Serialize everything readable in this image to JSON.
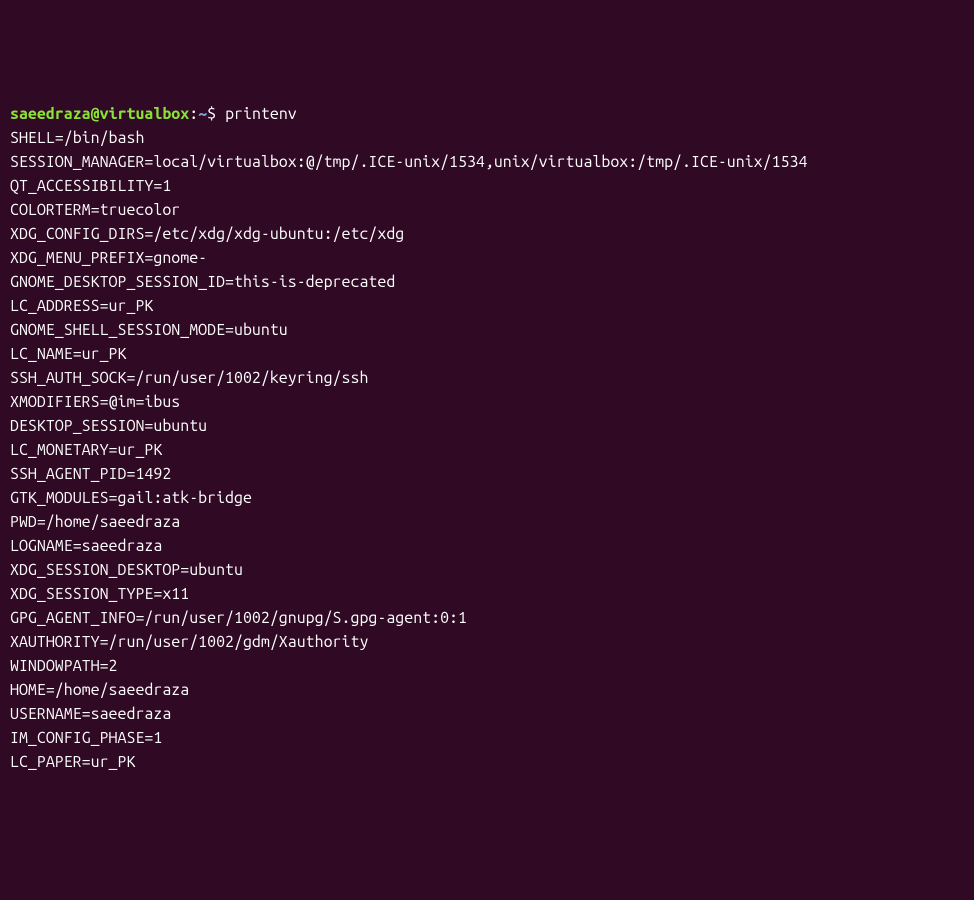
{
  "prompt": {
    "user": "saeedraza",
    "at": "@",
    "host": "virtualbox",
    "colon": ":",
    "path": "~",
    "dollar": "$ "
  },
  "command": "printenv",
  "output": [
    "SHELL=/bin/bash",
    "SESSION_MANAGER=local/virtualbox:@/tmp/.ICE-unix/1534,unix/virtualbox:/tmp/.ICE-unix/1534",
    "QT_ACCESSIBILITY=1",
    "COLORTERM=truecolor",
    "XDG_CONFIG_DIRS=/etc/xdg/xdg-ubuntu:/etc/xdg",
    "XDG_MENU_PREFIX=gnome-",
    "GNOME_DESKTOP_SESSION_ID=this-is-deprecated",
    "LC_ADDRESS=ur_PK",
    "GNOME_SHELL_SESSION_MODE=ubuntu",
    "LC_NAME=ur_PK",
    "SSH_AUTH_SOCK=/run/user/1002/keyring/ssh",
    "XMODIFIERS=@im=ibus",
    "DESKTOP_SESSION=ubuntu",
    "LC_MONETARY=ur_PK",
    "SSH_AGENT_PID=1492",
    "GTK_MODULES=gail:atk-bridge",
    "PWD=/home/saeedraza",
    "LOGNAME=saeedraza",
    "XDG_SESSION_DESKTOP=ubuntu",
    "XDG_SESSION_TYPE=x11",
    "GPG_AGENT_INFO=/run/user/1002/gnupg/S.gpg-agent:0:1",
    "XAUTHORITY=/run/user/1002/gdm/Xauthority",
    "WINDOWPATH=2",
    "HOME=/home/saeedraza",
    "USERNAME=saeedraza",
    "IM_CONFIG_PHASE=1",
    "LC_PAPER=ur_PK"
  ]
}
